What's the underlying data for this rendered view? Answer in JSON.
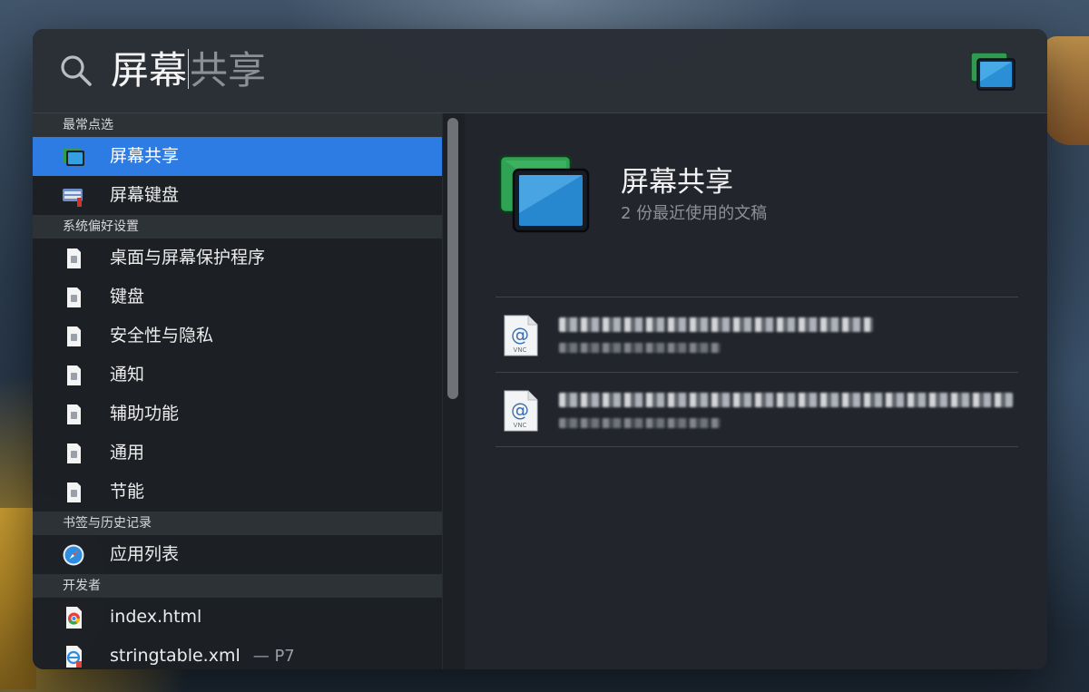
{
  "search": {
    "query_typed": "屏幕",
    "query_suggestion": "共享"
  },
  "sections": [
    {
      "header": "最常点选"
    },
    {
      "header": "系统偏好设置"
    },
    {
      "header": "书签与历史记录"
    },
    {
      "header": "开发者"
    }
  ],
  "rows": [
    {
      "label": "屏幕共享",
      "icon": "screen-sharing-icon",
      "selected": true
    },
    {
      "label": "屏幕键盘",
      "icon": "keyboard-viewer-icon"
    },
    {
      "label": "桌面与屏幕保护程序",
      "icon": "preference-file-icon"
    },
    {
      "label": "键盘",
      "icon": "preference-file-icon"
    },
    {
      "label": "安全性与隐私",
      "icon": "preference-file-icon"
    },
    {
      "label": "通知",
      "icon": "preference-file-icon"
    },
    {
      "label": "辅助功能",
      "icon": "preference-file-icon"
    },
    {
      "label": "通用",
      "icon": "preference-file-icon"
    },
    {
      "label": "节能",
      "icon": "preference-file-icon"
    },
    {
      "label": "应用列表",
      "icon": "safari-compass-icon"
    },
    {
      "label": "index.html",
      "icon": "chrome-html-icon"
    },
    {
      "label": "stringtable.xml",
      "suffix": "— P7",
      "icon": "xml-file-icon"
    }
  ],
  "preview": {
    "title": "屏幕共享",
    "subtitle": "2 份最近使用的文稿",
    "documents": [
      {
        "icon": "vnc-file-icon",
        "icon_label": "VNC"
      },
      {
        "icon": "vnc-file-icon",
        "icon_label": "VNC"
      }
    ]
  },
  "colors": {
    "selection": "#2d7ce4",
    "panel": "#22252b"
  }
}
